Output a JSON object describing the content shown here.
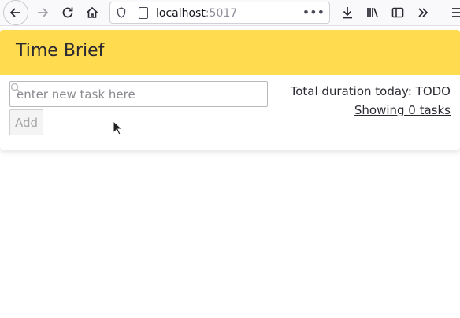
{
  "browser": {
    "url_host": "localhost",
    "url_port": ":5017",
    "more_glyph": "•••"
  },
  "app": {
    "title": "Time Brief",
    "task_input_placeholder": "enter new task here",
    "task_input_value": "",
    "add_label": "Add",
    "duration_text": "Total duration today: TODO",
    "showing_text": "Showing 0 tasks",
    "header_color": "#ffdb4f"
  }
}
